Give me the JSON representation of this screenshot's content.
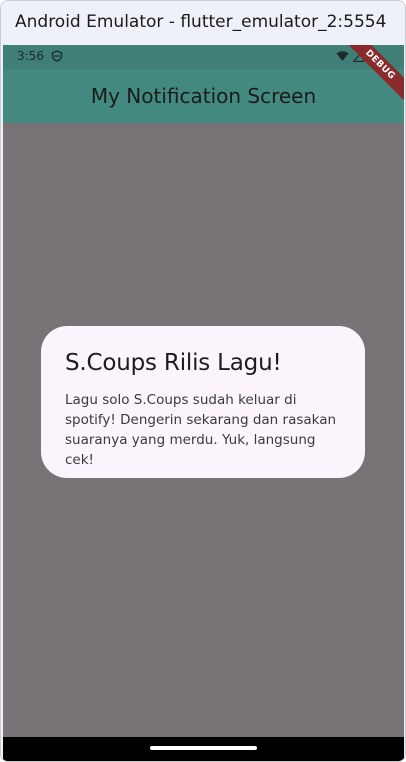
{
  "window": {
    "title": "Android Emulator - flutter_emulator_2:5554"
  },
  "status_bar": {
    "time": "3:56",
    "icons": [
      "shield-icon",
      "wifi-icon",
      "signal-icon",
      "battery-icon"
    ]
  },
  "app_bar": {
    "title": "My Notification Screen",
    "color": "#44897f"
  },
  "debug_banner": {
    "label": "DEBUG",
    "color": "#8a2b2b"
  },
  "dialog": {
    "title": "S.Coups Rilis Lagu!",
    "body": "Lagu solo S.Coups sudah keluar di spotify! Dengerin sekarang dan rasakan suaranya yang merdu. Yuk, langsung cek!",
    "background": "#fcf4fc"
  },
  "navigation_bar": {
    "icons": [
      "home-handle"
    ]
  }
}
